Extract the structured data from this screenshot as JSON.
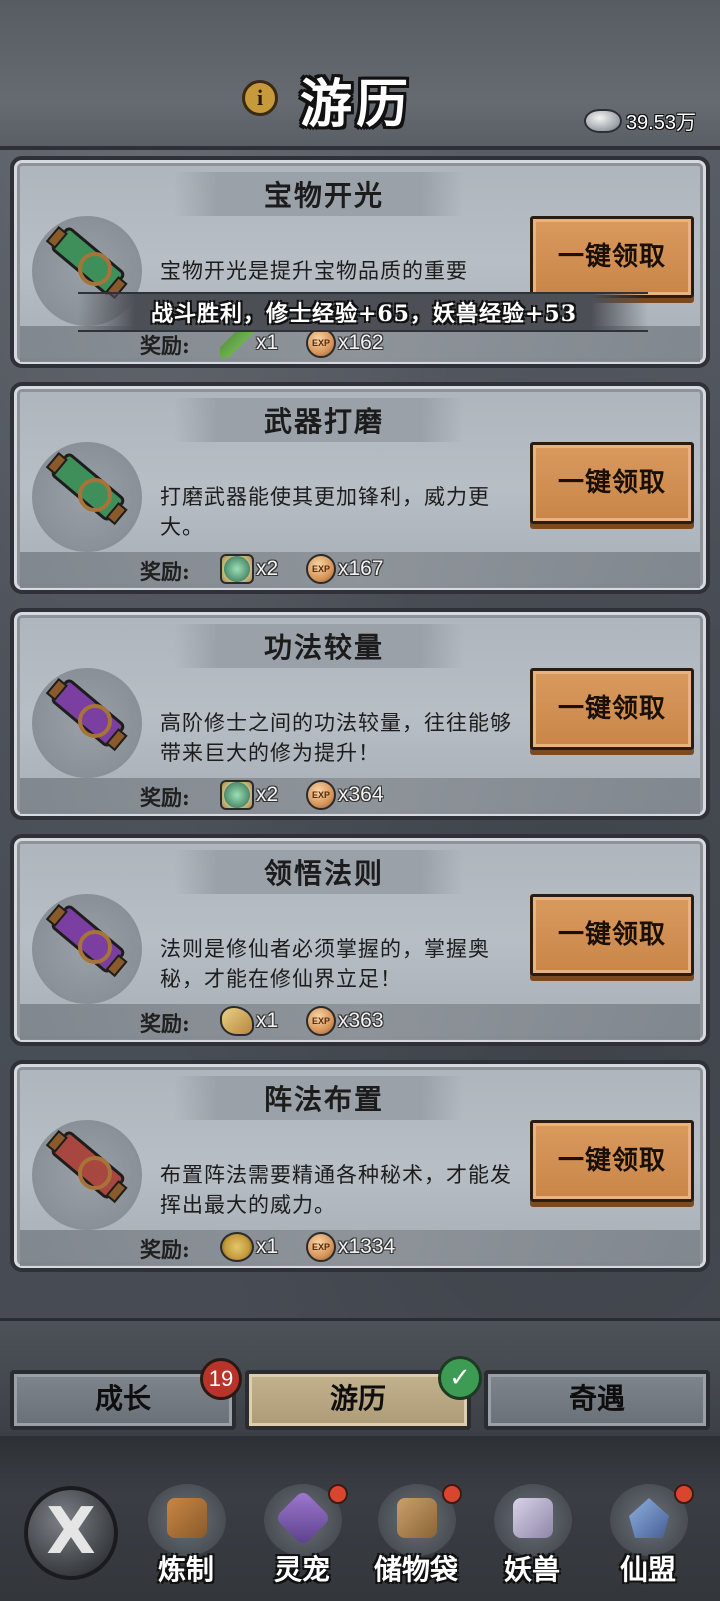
{
  "header": {
    "title": "游历",
    "info_icon": "i",
    "currency_value": "39.53万",
    "currency_icon": "silver-ingot-icon"
  },
  "quests": [
    {
      "title": "宝物开光",
      "description": "宝物开光是提升宝物品质的重要",
      "button_label": "一键领取",
      "reward_label": "奖励:",
      "item_icon": "herb-icon",
      "item_qty": "x1",
      "exp_qty": "x162",
      "scroll_color": "#3f8f5a"
    },
    {
      "title": "武器打磨",
      "description": "打磨武器能使其更加锋利，威力更大。",
      "button_label": "一键领取",
      "reward_label": "奖励:",
      "item_icon": "jade-talisman-icon",
      "item_qty": "x2",
      "exp_qty": "x167",
      "scroll_color": "#3f8f5a"
    },
    {
      "title": "功法较量",
      "description": "高阶修士之间的功法较量，往往能够带来巨大的修为提升！",
      "button_label": "一键领取",
      "reward_label": "奖励:",
      "item_icon": "jade-talisman-icon",
      "item_qty": "x2",
      "exp_qty": "x364",
      "scroll_color": "#7a3fa0"
    },
    {
      "title": "领悟法则",
      "description": "法则是修仙者必须掌握的，掌握奥秘，才能在修仙界立足！",
      "button_label": "一键领取",
      "reward_label": "奖励:",
      "item_icon": "cloud-scroll-icon",
      "item_qty": "x1",
      "exp_qty": "x363",
      "scroll_color": "#7a3fa0"
    },
    {
      "title": "阵法布置",
      "description": "布置阵法需要精通各种秘术，才能发挥出最大的威力。",
      "button_label": "一键领取",
      "reward_label": "奖励:",
      "item_icon": "yinyang-token-icon",
      "item_qty": "x1",
      "exp_qty": "x1334",
      "scroll_color": "#a8473f"
    }
  ],
  "exp_icon_text": "EXP",
  "toast": "战斗胜利，修士经验+65，妖兽经验+53",
  "tabs": [
    {
      "label": "成长",
      "badge": "19"
    },
    {
      "label": "游历",
      "badge": "✓"
    },
    {
      "label": "奇遇"
    }
  ],
  "close_label": "X",
  "nav": [
    {
      "label": "炼制",
      "icon": "forge-icon"
    },
    {
      "label": "灵宠",
      "icon": "spirit-pet-icon"
    },
    {
      "label": "储物袋",
      "icon": "storage-bag-icon"
    },
    {
      "label": "妖兽",
      "icon": "demon-beast-icon"
    },
    {
      "label": "仙盟",
      "icon": "immortal-guild-icon"
    }
  ],
  "colors": {
    "button": "#d3925a",
    "active_tab": "#b9a883",
    "badge_red": "#b8342a",
    "badge_green": "#3d9b54"
  }
}
